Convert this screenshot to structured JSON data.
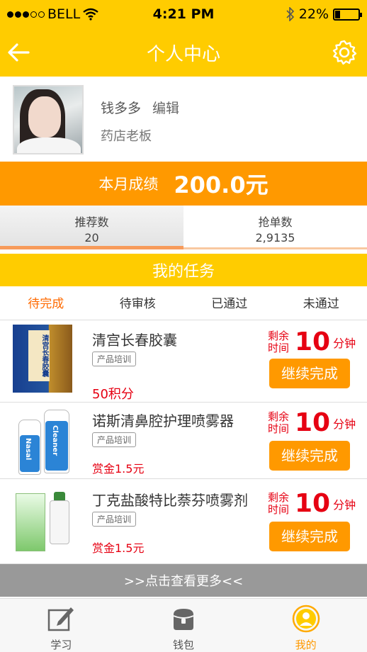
{
  "status_bar": {
    "carrier": "BELL",
    "time": "4:21 PM",
    "battery": "22%",
    "battery_level": 0.22
  },
  "nav": {
    "title": "个人中心",
    "back_icon": "arrow-left-icon",
    "settings_icon": "gear-icon"
  },
  "profile": {
    "name": "钱多多",
    "edit_label": "编辑",
    "role": "药店老板"
  },
  "performance": {
    "label": "本月成绩",
    "value": "200.0元"
  },
  "stats": {
    "recommend_label": "推荐数",
    "recommend_value": "20",
    "orders_label": "抢单数",
    "orders_value": "2,9135"
  },
  "tasks": {
    "header": "我的任务",
    "tabs": [
      "待完成",
      "待审核",
      "已通过",
      "未通过"
    ],
    "items": [
      {
        "title": "清宫长春胶囊",
        "tag": "产品培训",
        "reward": "50积分",
        "timer_label": "剩余时间",
        "timer_value": "10",
        "timer_unit": "分钟",
        "button": "继续完成"
      },
      {
        "title": "诺斯清鼻腔护理喷雾器",
        "tag": "产品培训",
        "reward": "赏金1.5元",
        "timer_label": "剩余时间",
        "timer_value": "10",
        "timer_unit": "分钟",
        "button": "继续完成"
      },
      {
        "title": "丁克盐酸特比萘芬喷雾剂",
        "tag": "产品培训",
        "reward": "赏金1.5元",
        "timer_label": "剩余时间",
        "timer_value": "10",
        "timer_unit": "分钟",
        "button": "继续完成"
      }
    ],
    "see_more": ">>点击查看更多<<"
  },
  "bottom_tabs": [
    {
      "label": "学习",
      "icon": "pencil-edit-icon"
    },
    {
      "label": "钱包",
      "icon": "wallet-icon"
    },
    {
      "label": "我的",
      "icon": "user-icon"
    }
  ],
  "colors": {
    "brand_yellow": "#ffcc00",
    "accent_orange": "#ff9900",
    "alert_red": "#e60012",
    "active_tab": "#ff6a00"
  }
}
